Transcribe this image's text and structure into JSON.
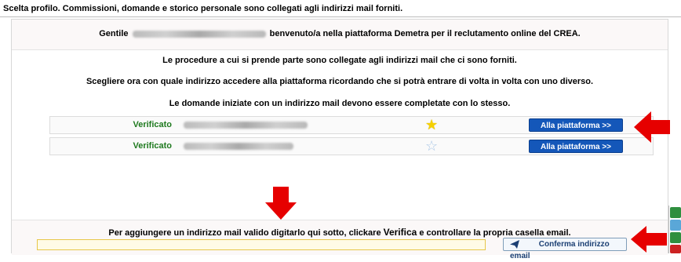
{
  "header": {
    "title": "Scelta profilo. Commissioni, domande e storico personale sono collegati agli indirizzi mail forniti."
  },
  "greeting": {
    "prefix": "Gentile",
    "suffix": "benvenuto/a nella piattaforma Demetra per il reclutamento online del CREA."
  },
  "instructions": [
    "Le procedure a cui si prende parte sono collegate agli indirizzi mail che ci sono forniti.",
    "Scegliere ora con quale indirizzo accedere alla piattaforma ricordando che si potrà entrare di volta in volta con uno diverso.",
    "Le domande iniziate con un indirizzo mail devono essere completate con lo stesso."
  ],
  "emails": [
    {
      "status": "Verificato",
      "favorite": true,
      "button": "Alla piattaforma >>"
    },
    {
      "status": "Verificato",
      "favorite": false,
      "button": "Alla piattaforma >>"
    }
  ],
  "add_email": {
    "text_before": "Per aggiungere un indirizzo mail valido digitarlo qui sotto, clickare ",
    "verifica": "Verifica",
    "text_after": " e controllare la propria casella email.",
    "input_value": "",
    "confirm_button": "Conferma indirizzo email"
  },
  "icons": {
    "star_filled": "star-filled-icon",
    "star_empty": "star-outline-icon",
    "send": "paper-plane-icon",
    "arrow": "red-arrow-icon"
  },
  "colors": {
    "verified": "#1f7a1f",
    "button_primary": "#1457b9",
    "star_filled": "#f5d000",
    "star_empty": "#aac7e6",
    "arrow": "#e60000"
  }
}
